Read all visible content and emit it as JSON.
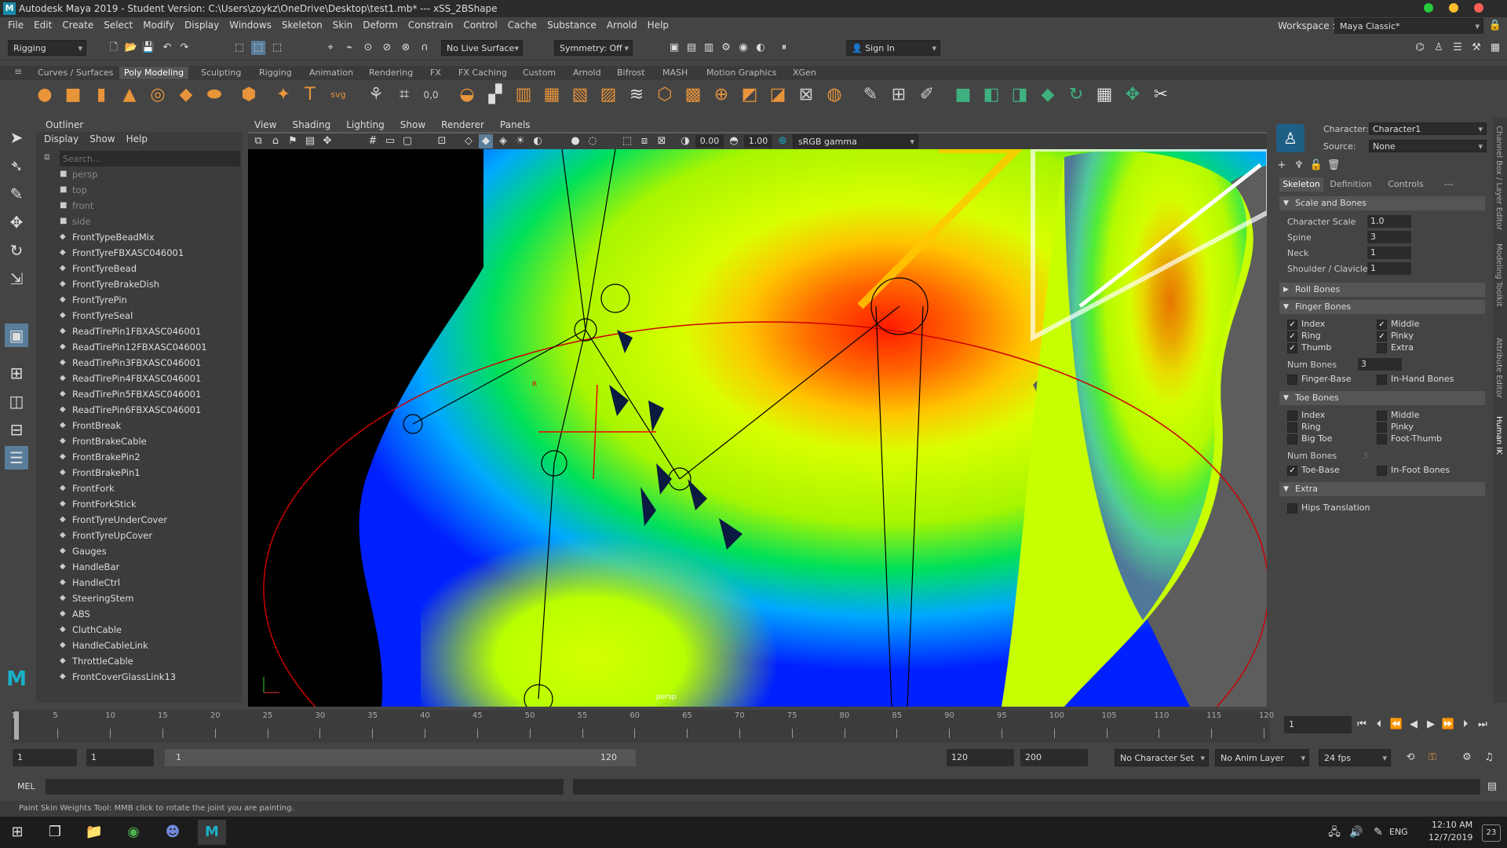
{
  "titlebar": {
    "logo": "M",
    "title": "Autodesk Maya 2019 - Student Version: C:\\Users\\zoykz\\OneDrive\\Desktop\\test1.mb*  ---  xSS_2BShape"
  },
  "menubar": {
    "items": [
      "File",
      "Edit",
      "Create",
      "Select",
      "Modify",
      "Display",
      "Windows",
      "Skeleton",
      "Skin",
      "Deform",
      "Constrain",
      "Control",
      "Cache",
      "Substance",
      "Arnold",
      "Help"
    ],
    "workspace_label": "Workspace :",
    "workspace_value": "Maya Classic*"
  },
  "statusline": {
    "menuset": "Rigging",
    "live_surface": "No Live Surface",
    "symmetry": "Symmetry: Off",
    "sign_in": "Sign In"
  },
  "shelf_tabs": [
    "Curves / Surfaces",
    "Poly Modeling",
    "Sculpting",
    "Rigging",
    "Animation",
    "Rendering",
    "FX",
    "FX Caching",
    "Custom",
    "Arnold",
    "Bifrost",
    "MASH",
    "Motion Graphics",
    "XGen"
  ],
  "shelf_active": "Poly Modeling",
  "outliner": {
    "title": "Outliner",
    "menu": [
      "Display",
      "Show",
      "Help"
    ],
    "search_placeholder": "Search...",
    "items": [
      {
        "label": "persp",
        "dim": true
      },
      {
        "label": "top",
        "dim": true
      },
      {
        "label": "front",
        "dim": true
      },
      {
        "label": "side",
        "dim": true
      },
      {
        "label": "FrontTypeBeadMix"
      },
      {
        "label": "FrontTyreFBXASC046001"
      },
      {
        "label": "FrontTyreBead"
      },
      {
        "label": "FrontTyreBrakeDish"
      },
      {
        "label": "FrontTyrePin"
      },
      {
        "label": "FrontTyreSeal"
      },
      {
        "label": "ReadTirePin1FBXASC046001"
      },
      {
        "label": "ReadTirePin12FBXASC046001"
      },
      {
        "label": "ReadTirePin3FBXASC046001"
      },
      {
        "label": "ReadTirePin4FBXASC046001"
      },
      {
        "label": "ReadTirePin5FBXASC046001"
      },
      {
        "label": "ReadTirePin6FBXASC046001"
      },
      {
        "label": "FrontBreak"
      },
      {
        "label": "FrontBrakeCable"
      },
      {
        "label": "FrontBrakePin2"
      },
      {
        "label": "FrontBrakePin1"
      },
      {
        "label": "FrontFork"
      },
      {
        "label": "FrontForkStick"
      },
      {
        "label": "FrontTyreUnderCover"
      },
      {
        "label": "FrontTyreUpCover"
      },
      {
        "label": "Gauges"
      },
      {
        "label": "HandleBar"
      },
      {
        "label": "HandleCtrl"
      },
      {
        "label": "SteeringStem"
      },
      {
        "label": "ABS"
      },
      {
        "label": "CluthCable"
      },
      {
        "label": "HandleCableLink"
      },
      {
        "label": "ThrottleCable"
      },
      {
        "label": "FrontCoverGlassLink13"
      }
    ]
  },
  "viewport": {
    "menu": [
      "View",
      "Shading",
      "Lighting",
      "Show",
      "Renderer",
      "Panels"
    ],
    "exposure": "0.00",
    "gamma": "1.00",
    "colorspace": "sRGB gamma",
    "camera_label": "persp"
  },
  "hik": {
    "character_label": "Character:",
    "character_value": "Character1",
    "source_label": "Source:",
    "source_value": "None",
    "tabs": [
      "Skeleton",
      "Definition",
      "Controls",
      "---"
    ],
    "active_tab": "Skeleton",
    "scale_section": "Scale and Bones",
    "character_scale_label": "Character Scale",
    "character_scale": "1.0",
    "spine_label": "Spine",
    "spine": "3",
    "neck_label": "Neck",
    "neck": "1",
    "shoulder_label": "Shoulder / Clavicle",
    "shoulder": "1",
    "roll_section": "Roll Bones",
    "finger_section": "Finger Bones",
    "finger_checks": [
      {
        "label": "Index",
        "checked": true
      },
      {
        "label": "Middle",
        "checked": true
      },
      {
        "label": "Ring",
        "checked": true
      },
      {
        "label": "Pinky",
        "checked": true
      },
      {
        "label": "Thumb",
        "checked": true
      },
      {
        "label": "Extra",
        "checked": false
      }
    ],
    "finger_num_label": "Num Bones",
    "finger_num": "3",
    "finger_base": "Finger-Base",
    "in_hand": "In-Hand Bones",
    "toe_section": "Toe Bones",
    "toe_checks": [
      {
        "label": "Index",
        "checked": false
      },
      {
        "label": "Middle",
        "checked": false
      },
      {
        "label": "Ring",
        "checked": false
      },
      {
        "label": "Pinky",
        "checked": false
      },
      {
        "label": "Big Toe",
        "checked": false
      },
      {
        "label": "Foot-Thumb",
        "checked": false
      }
    ],
    "toe_num_label": "Num Bones",
    "toe_num": "3",
    "toe_base": "Toe-Base",
    "in_foot": "In-Foot Bones",
    "extra_section": "Extra",
    "hips": "Hips Translation"
  },
  "side_tabs": [
    "Channel Box / Layer Editor",
    "Modeling Toolkit",
    "Attribute Editor",
    "Human IK"
  ],
  "timeline": {
    "ticks": [
      1,
      5,
      10,
      15,
      20,
      25,
      30,
      35,
      40,
      45,
      50,
      55,
      60,
      65,
      70,
      75,
      80,
      85,
      90,
      95,
      100,
      105,
      110,
      115,
      120
    ],
    "current_frame": "1"
  },
  "range": {
    "start": "1",
    "anim_start": "1",
    "range_start": "1",
    "range_end": "120",
    "anim_end": "120",
    "end": "200",
    "character_set": "No Character Set",
    "anim_layer": "No Anim Layer",
    "fps": "24 fps"
  },
  "cmdline": {
    "label": "MEL"
  },
  "helpline": "Paint Skin Weights Tool: MMB click to rotate the joint you are painting.",
  "taskbar": {
    "lang": "ENG",
    "time": "12:10 AM",
    "date": "12/7/2019",
    "notif": "23"
  }
}
